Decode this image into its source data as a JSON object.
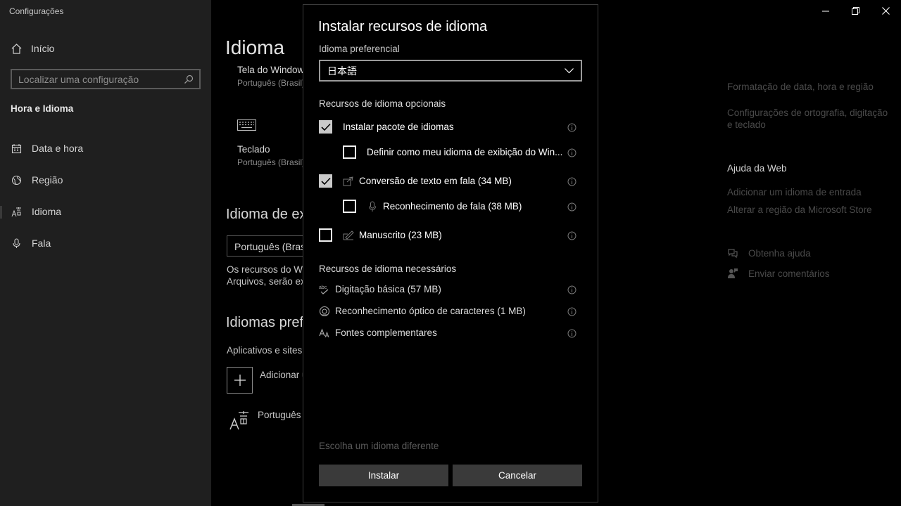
{
  "window": {
    "app_title": "Configurações"
  },
  "sidebar": {
    "home_label": "Início",
    "search_placeholder": "Localizar uma configuração",
    "section_title": "Hora e Idioma",
    "items": [
      {
        "label": "Data e hora",
        "icon": "calendar-icon"
      },
      {
        "label": "Região",
        "icon": "globe-icon"
      },
      {
        "label": "Idioma",
        "icon": "language-icon",
        "active": true
      },
      {
        "label": "Fala",
        "icon": "microphone-icon"
      }
    ]
  },
  "main": {
    "title": "Idioma",
    "tiles": [
      {
        "label": "Tela do Windows",
        "sub": "Português (Brasil)"
      },
      {
        "label": "Teclado",
        "sub": "Português (Brasil)"
      }
    ],
    "display_lang_title": "Idioma de exi",
    "display_lang_value": "Português (Brasil",
    "display_lang_text_1": "Os recursos do Wind",
    "display_lang_text_2": "Arquivos, serão exi",
    "preferred_title": "Idiomas prefe",
    "preferred_text": "Aplicativos e sites a",
    "add_label": "Adicionar u",
    "lang_item": "Português ("
  },
  "right_panel": {
    "links_top": [
      "Formatação de data, hora e região",
      "Configurações de ortografia, digitação e teclado"
    ],
    "web_help_title": "Ajuda da Web",
    "web_links": [
      "Adicionar um idioma de entrada",
      "Alterar a região da Microsoft Store"
    ],
    "help_items": [
      {
        "label": "Obtenha ajuda",
        "icon": "help-chat-icon"
      },
      {
        "label": "Enviar comentários",
        "icon": "feedback-icon"
      }
    ]
  },
  "dialog": {
    "title": "Instalar recursos de idioma",
    "preferred_label": "Idioma preferencial",
    "preferred_value": "日本語",
    "optional_title": "Recursos de idioma opcionais",
    "options": [
      {
        "label": "Instalar pacote de idiomas",
        "checked": true
      },
      {
        "label": "Definir como meu idioma de exibição do Win...",
        "checked": false
      },
      {
        "label": "Conversão de texto em fala (34 MB)",
        "checked": true,
        "icon": "speech-icon"
      },
      {
        "label": "Reconhecimento de fala (38 MB)",
        "checked": false,
        "icon": "microphone-icon"
      },
      {
        "label": "Manuscrito (23 MB)",
        "checked": false,
        "icon": "handwriting-icon"
      }
    ],
    "required_title": "Recursos de idioma necessários",
    "required": [
      {
        "label": "Digitação básica (57 MB)",
        "icon": "spellcheck-icon"
      },
      {
        "label": "Reconhecimento óptico de caracteres (1 MB)",
        "icon": "ocr-icon"
      },
      {
        "label": "Fontes complementares",
        "icon": "font-icon"
      }
    ],
    "choose_other": "Escolha um idioma diferente",
    "install_label": "Instalar",
    "cancel_label": "Cancelar"
  }
}
